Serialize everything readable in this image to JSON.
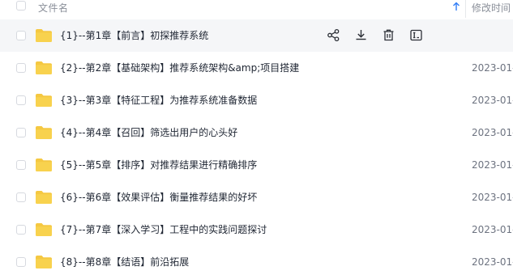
{
  "header": {
    "name_col": "文件名",
    "date_col": "修改时间"
  },
  "row_actions": [
    "share-icon",
    "download-icon",
    "delete-icon",
    "rename-icon"
  ],
  "colors": {
    "folder": "#f5c842",
    "sort_arrow": "#2f7cf6",
    "hover_row": "#f5f6f8"
  },
  "files": [
    {
      "name": "{1}--第1章【前言】初探推荐系统",
      "date": ""
    },
    {
      "name": "{2}--第2章【基础架构】推荐系统架构&amp;项目搭建",
      "date": "2023-01-"
    },
    {
      "name": "{3}--第3章【特征工程】为推荐系统准备数据",
      "date": "2023-01-"
    },
    {
      "name": "{4}--第4章【召回】筛选出用户的心头好",
      "date": "2023-01-"
    },
    {
      "name": "{5}--第5章【排序】对推荐结果进行精确排序",
      "date": "2023-01-"
    },
    {
      "name": "{6}--第6章【效果评估】衡量推荐结果的好坏",
      "date": "2023-01-"
    },
    {
      "name": "{7}--第7章【深入学习】工程中的实践问题探讨",
      "date": "2023-01-"
    },
    {
      "name": "{8}--第8章【结语】前沿拓展",
      "date": "2023-01-"
    }
  ]
}
